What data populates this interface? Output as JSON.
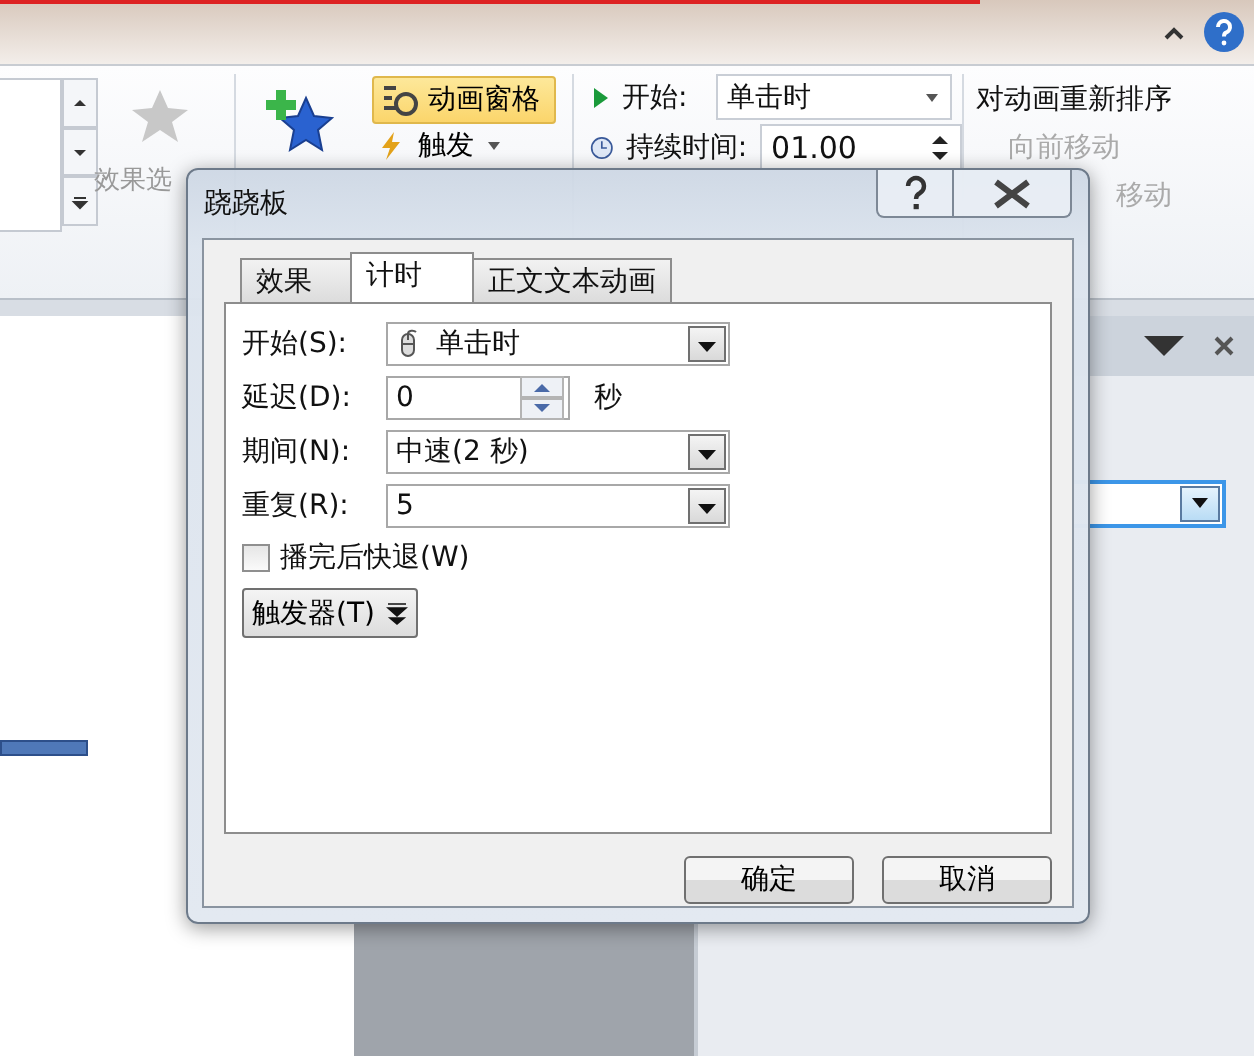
{
  "ribbon": {
    "effect_options_label": "效果选",
    "animation_pane_button": {
      "label": "动画窗格",
      "selected": true
    },
    "trigger_button": {
      "label": "触发"
    },
    "start_label": "开始:",
    "start_value": "单击时",
    "duration_label": "持续时间:",
    "duration_value": "01.00",
    "reorder_title": "对动画重新排序",
    "move_earlier": {
      "label": "向前移动",
      "disabled": true
    },
    "move_later": {
      "label": "移动",
      "disabled": true
    }
  },
  "dialog": {
    "title": "跷跷板",
    "tabs": [
      {
        "label": "效果",
        "selected": false
      },
      {
        "label": "计时",
        "selected": true
      },
      {
        "label": "正文文本动画",
        "selected": false
      }
    ],
    "fields": [
      {
        "kind": "combo",
        "label": "开始(S):",
        "value": "单击时"
      },
      {
        "kind": "spinner",
        "label": "延迟(D):",
        "value": "0",
        "unit": "秒"
      },
      {
        "kind": "combo",
        "label": "期间(N):",
        "value": "中速(2 秒)"
      },
      {
        "kind": "combo",
        "label": "重复(R):",
        "value": "5"
      }
    ],
    "checkbox": {
      "label": "播完后快退(W)",
      "checked": false
    },
    "trigger_button": {
      "label": "触发器(T)"
    },
    "buttons": [
      {
        "label": "确定"
      },
      {
        "label": "取消"
      }
    ]
  }
}
